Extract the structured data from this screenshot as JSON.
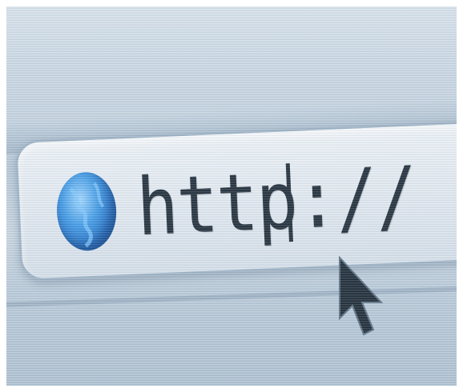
{
  "address_bar": {
    "url": "http://",
    "globe_icon": "globe-icon",
    "caret_icon": "text-caret"
  },
  "pointer": {
    "icon": "arrow-pointer-icon"
  },
  "colors": {
    "screen_blue": "#c4d3e0",
    "bar_fill": "#e4ebf2",
    "bar_border": "#9eb3c6",
    "text": "#1c2a36",
    "globe": "#1e6dc4"
  }
}
